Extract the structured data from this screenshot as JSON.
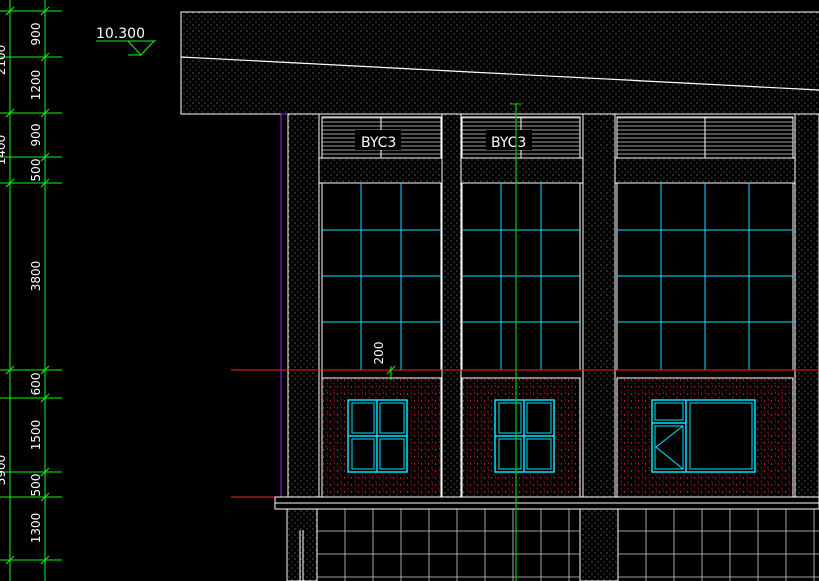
{
  "drawing": {
    "elevation_mark": "10.300",
    "window_tags": [
      "BYC3",
      "BYC3"
    ],
    "inline_dimension": "200",
    "left_dimension_chain": [
      "900",
      "1200",
      "900",
      "500",
      "3800",
      "600",
      "1500",
      "500",
      "1300"
    ],
    "overall_dimensions_partial": [
      "2100",
      "1400",
      "5900"
    ]
  },
  "colors": {
    "background": "#000000",
    "dimension_lines": "#00ff00",
    "glazing": "#00e5ff",
    "outlines": "#ffffff",
    "level_lines": "#ff2020",
    "axis": "#00c800",
    "accent_purple": "#a020ff"
  }
}
